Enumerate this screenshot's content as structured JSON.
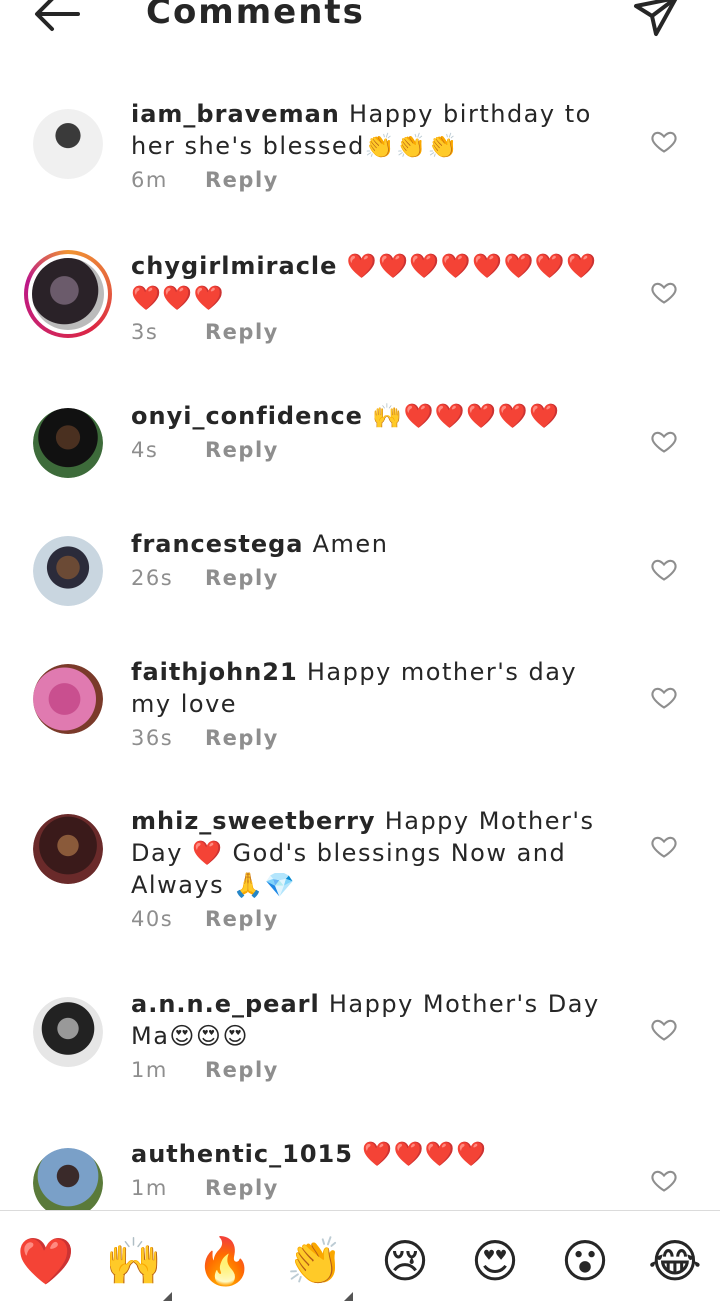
{
  "header": {
    "title": "Comments",
    "back_icon": "back-arrow-icon",
    "send_icon": "paper-plane-icon"
  },
  "comments": [
    {
      "username": "iam_braveman",
      "text": "Happy birthday to her she's blessed👏👏👏",
      "time": "6m",
      "reply": "Reply"
    },
    {
      "username": "chygirlmiracle",
      "text": "❤️❤️❤️❤️❤️❤️❤️❤️❤️❤️❤️",
      "time": "3s",
      "reply": "Reply"
    },
    {
      "username": "onyi_confidence",
      "text": "🙌❤️❤️❤️❤️❤️",
      "time": "4s",
      "reply": "Reply"
    },
    {
      "username": "francestega",
      "text": "Amen",
      "time": "26s",
      "reply": "Reply"
    },
    {
      "username": "faithjohn21",
      "text": "Happy mother's day my love",
      "time": "36s",
      "reply": "Reply"
    },
    {
      "username": "mhiz_sweetberry",
      "text": "Happy Mother's Day ❤️ God's blessings Now and Always 🙏💎",
      "time": "40s",
      "reply": "Reply"
    },
    {
      "username": "a.n.n.e_pearl",
      "text": "Happy Mother's Day Ma😍😍😍",
      "time": "1m",
      "reply": "Reply"
    },
    {
      "username": "authentic_1015",
      "text": "❤️❤️❤️❤️",
      "time": "1m",
      "reply": "Reply"
    }
  ],
  "reactions": [
    "❤️",
    "🙌",
    "🔥",
    "👏",
    "😢",
    "😍",
    "😮",
    "😂"
  ],
  "colors": {
    "text": "#262626",
    "muted": "#8e8e8e",
    "divider": "#dbdbdb"
  }
}
